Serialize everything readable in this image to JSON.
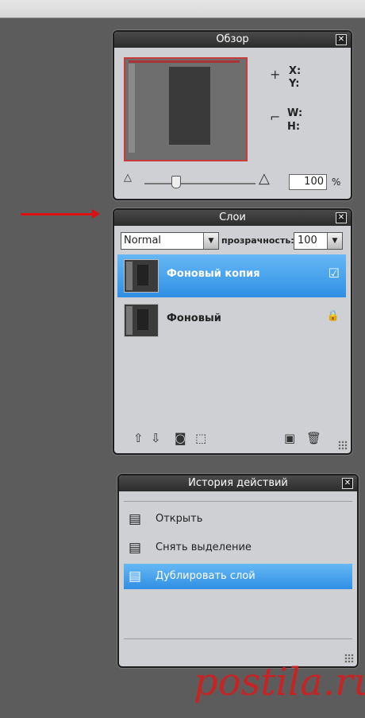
{
  "overview": {
    "title": "Обзор",
    "close": "✕",
    "coords": {
      "x": "X:",
      "y": "Y:",
      "w": "W:",
      "h": "H:"
    },
    "zoom": "100",
    "zoom_unit": "%"
  },
  "layers": {
    "title": "Слои",
    "close": "✕",
    "blend_mode": "Normal",
    "opacity_label": "прозрачность:",
    "opacity": "100",
    "items": [
      {
        "name": "Фоновый копия",
        "state": "☑",
        "selected": true
      },
      {
        "name": "Фоновый",
        "state": "🔒",
        "selected": false
      }
    ]
  },
  "history": {
    "title": "История действий",
    "close": "✕",
    "items": [
      {
        "label": "Открыть",
        "selected": false
      },
      {
        "label": "Снять выделение",
        "selected": false
      },
      {
        "label": "Дублировать слой",
        "selected": true
      }
    ]
  },
  "colors": {
    "selection": "#3a9ae8",
    "panel": "#ced0d3",
    "title_bar": "#2c2c2c",
    "background": "#5c5c5c",
    "arrow": "#dd1111"
  },
  "watermark": "postila.ru"
}
